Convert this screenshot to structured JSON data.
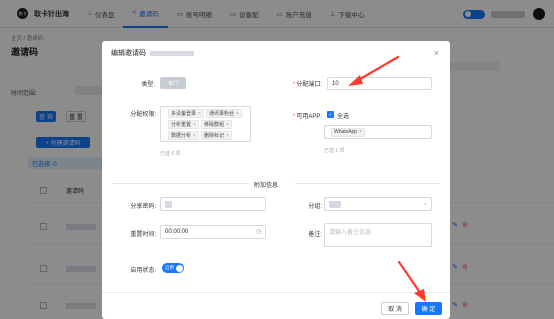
{
  "topbar": {
    "logo_text": "取卡",
    "app_title": "取卡针出海",
    "nav": [
      {
        "icon": "home-icon",
        "glyph": "⌂",
        "label": "仪表盘",
        "active": false
      },
      {
        "icon": "share-icon",
        "glyph": "<",
        "label": "邀请码",
        "active": true
      },
      {
        "icon": "monitor-icon",
        "glyph": "▭",
        "label": "账号明细",
        "active": false
      },
      {
        "icon": "card-icon",
        "glyph": "▭",
        "label": "设备配",
        "active": false
      },
      {
        "icon": "wallet-icon",
        "glyph": "▭",
        "label": "账户充值",
        "active": false
      },
      {
        "icon": "download-icon",
        "glyph": "⊥",
        "label": "下载中心",
        "active": false
      }
    ]
  },
  "page": {
    "breadcrumb": "主页 / 邀请码",
    "title": "邀请码",
    "filter_label": "时间范围:",
    "search_btn": "查 询",
    "reset_btn": "重 置",
    "create_btn": "+ 创建邀请码",
    "selected_text": "已选择: 0",
    "col_invite": "邀请码"
  },
  "modal": {
    "title": "编辑邀请码",
    "close": "×",
    "type_label": "类型:",
    "type_value": "单门",
    "slot_label": "分配端口:",
    "slot_value": "10",
    "perm_label": "分配权限:",
    "perm_tags": [
      [
        "多设备登录",
        "通讯录粉丝"
      ],
      [
        "分析重置",
        "移除群组"
      ],
      [
        "数据分析",
        "删除标记"
      ]
    ],
    "perm_count": "已选 6 项",
    "app_label": "可用APP:",
    "select_all": "全选",
    "app_tags": [
      "WhatsApp"
    ],
    "app_count": "已选 1 项",
    "section_title": "附加信息",
    "share_code_label": "分享密码:",
    "group_label": "分组:",
    "reset_time_label": "重置时间:",
    "reset_time_value": "00:00:00",
    "remark_label": "备注:",
    "remark_placeholder": "请输入备注信息",
    "enable_label": "启用状态:",
    "enable_value": "启用",
    "cancel_btn": "取 消",
    "confirm_btn": "确 定"
  },
  "colors": {
    "primary": "#1677ff",
    "annotation": "#ff3b30"
  }
}
